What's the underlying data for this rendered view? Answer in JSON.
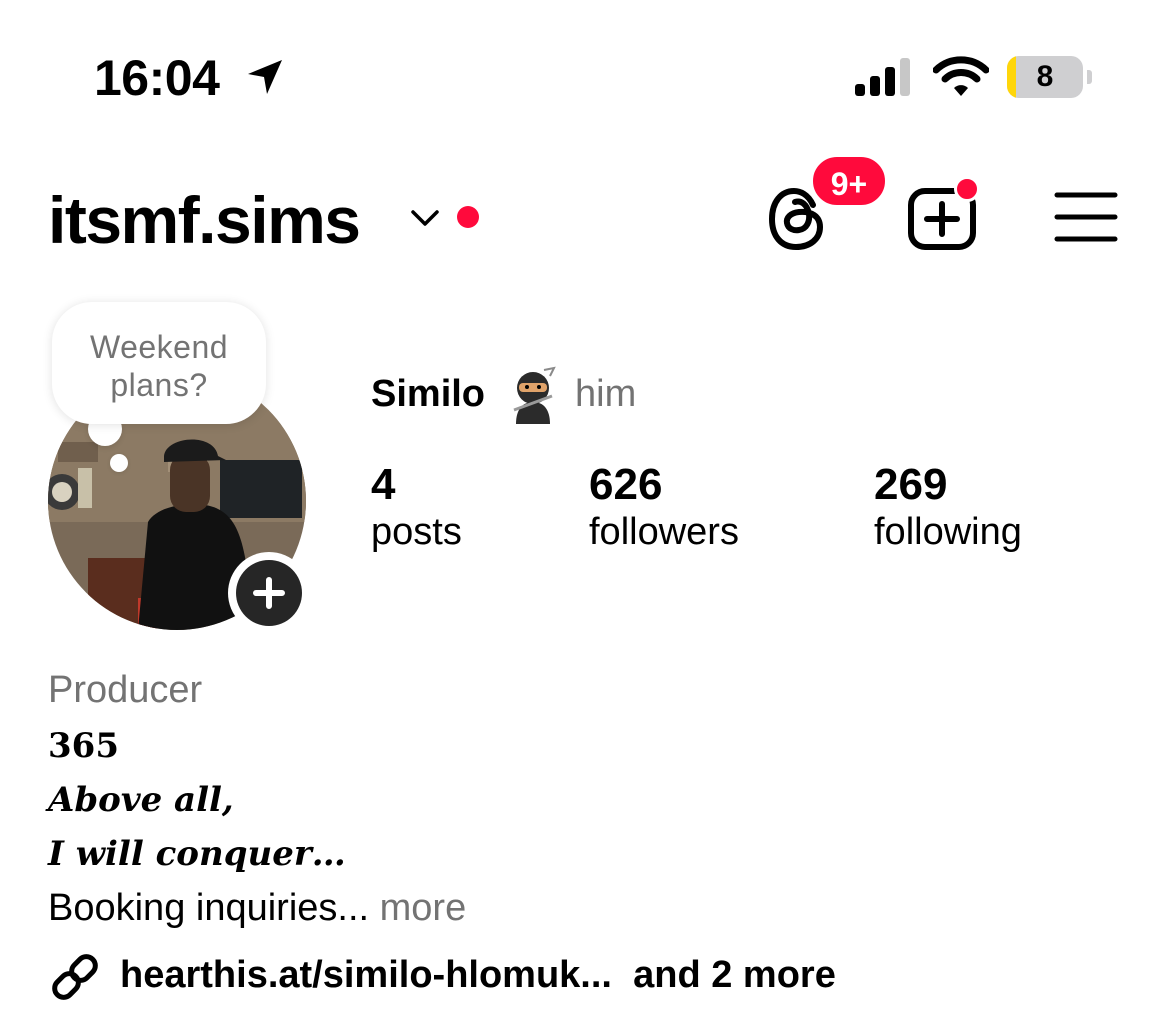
{
  "status_bar": {
    "time": "16:04",
    "battery_level": "8",
    "battery_fraction": 0.08,
    "battery_color": "#ffd60a",
    "icons": [
      "location-arrow-icon",
      "cellular-signal-icon",
      "wifi-icon",
      "battery-icon"
    ]
  },
  "header": {
    "username": "itsmf.sims",
    "threads_badge": "9+",
    "icons": [
      "chevron-down-icon",
      "threads-icon",
      "create-icon",
      "menu-icon"
    ],
    "accent_color": "#ff0a3c"
  },
  "note": {
    "line1": "Weekend",
    "line2": "plans?"
  },
  "profile": {
    "display_name": "Similo",
    "name_emoji": "ninja-emoji",
    "pronouns": "him"
  },
  "stats": {
    "posts": {
      "value": "4",
      "label": "posts"
    },
    "followers": {
      "value": "626",
      "label": "followers"
    },
    "following": {
      "value": "269",
      "label": "following"
    }
  },
  "bio": {
    "category": "Producer",
    "line1": "365",
    "line2": "Above all,",
    "line3": "I will conquer…",
    "line4": "Booking inquiries...",
    "more": "more"
  },
  "links": {
    "primary": "hearthis.at/similo-hlomuk...",
    "extra": "and 2 more"
  }
}
